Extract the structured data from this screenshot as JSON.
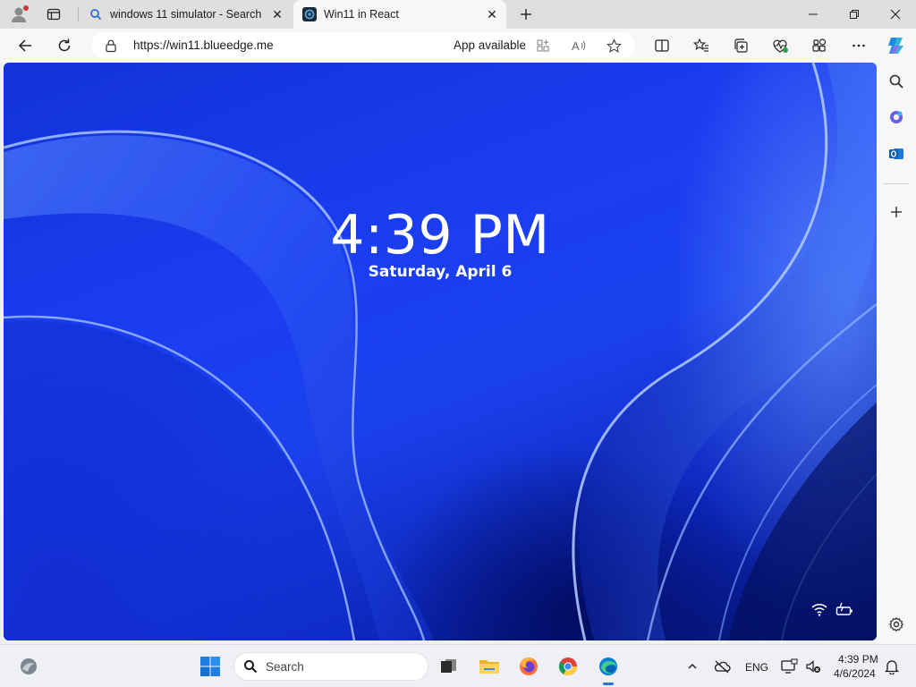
{
  "browser": {
    "tabs": [
      {
        "title": "windows 11 simulator - Search",
        "icon": "search-icon",
        "active": false
      },
      {
        "title": "Win11 in React",
        "icon": "site-favicon",
        "active": true
      }
    ],
    "url": "https://win11.blueedge.me",
    "app_available_label": "App available",
    "toolbar_icons": [
      "back-icon",
      "refresh-icon",
      "lock-icon",
      "install-app-icon",
      "read-aloud-icon",
      "favorite-star-icon",
      "split-screen-icon",
      "favorites-icon",
      "collections-icon",
      "browser-essentials-icon",
      "extensions-icon",
      "more-icon",
      "copilot-icon"
    ],
    "window_controls": [
      "minimize-icon",
      "restore-icon",
      "close-icon"
    ],
    "sidebar_icons": [
      "search-icon",
      "copilot-apps-icon",
      "outlook-icon",
      "add-icon",
      "settings-icon"
    ]
  },
  "lockscreen": {
    "time": "4:39 PM",
    "date": "Saturday, April 6",
    "status_icons": [
      "wifi-icon",
      "battery-icon"
    ]
  },
  "taskbar": {
    "search_placeholder": "Search",
    "pinned": [
      "widgets-icon",
      "start-icon",
      "task-view-icon",
      "file-explorer-icon",
      "firefox-icon",
      "chrome-icon",
      "edge-icon"
    ],
    "tray": {
      "language": "ENG",
      "time": "4:39 PM",
      "date": "4/6/2024"
    }
  }
}
